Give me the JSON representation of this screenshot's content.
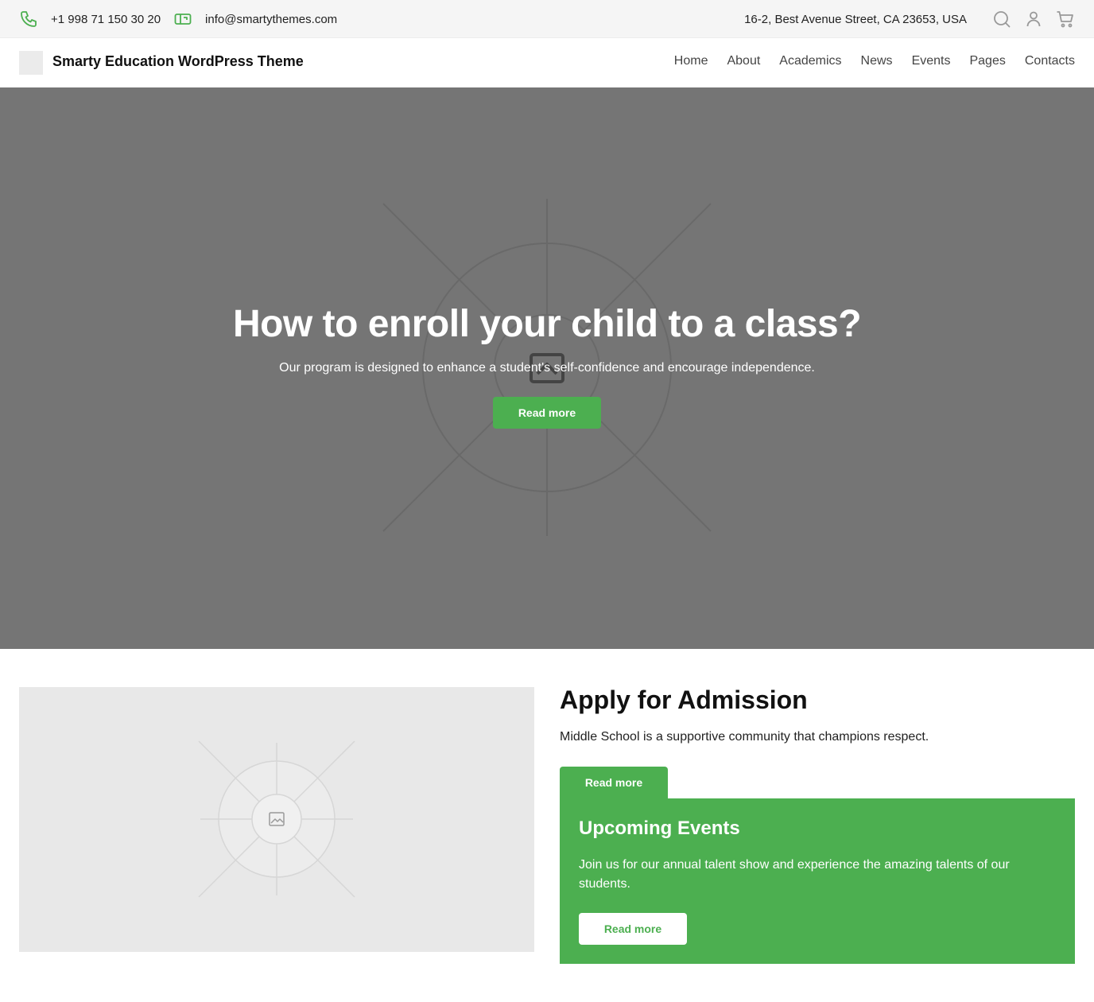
{
  "topbar": {
    "phone": "+1 998 71 150 30 20",
    "email": "info@smartythemes.com",
    "address": "16-2, Best Avenue Street, CA 23653, USA",
    "icons": [
      "phone-icon",
      "mail-icon",
      "search-icon",
      "user-icon",
      "cart-icon"
    ],
    "accent_color": "#4caf50"
  },
  "header": {
    "site_title": "Smarty Education WordPress Theme",
    "nav": [
      "Home",
      "About",
      "Academics",
      "News",
      "Events",
      "Pages",
      "Contacts"
    ]
  },
  "hero": {
    "title": "How to enroll your child to a class?",
    "subtitle": "Our program is designed to enhance a student's self-confidence and encourage independence.",
    "button_label": "Read more",
    "background_color": "#757575"
  },
  "admission": {
    "title": "Apply for Admission",
    "text": "Middle School is a supportive community that champions respect.",
    "button_label": "Read more"
  },
  "events": {
    "title": "Upcoming Events",
    "text": "Join us for our annual talent show and experience the amazing talents of our students.",
    "button_label": "Read more",
    "background_color": "#4caf50"
  }
}
